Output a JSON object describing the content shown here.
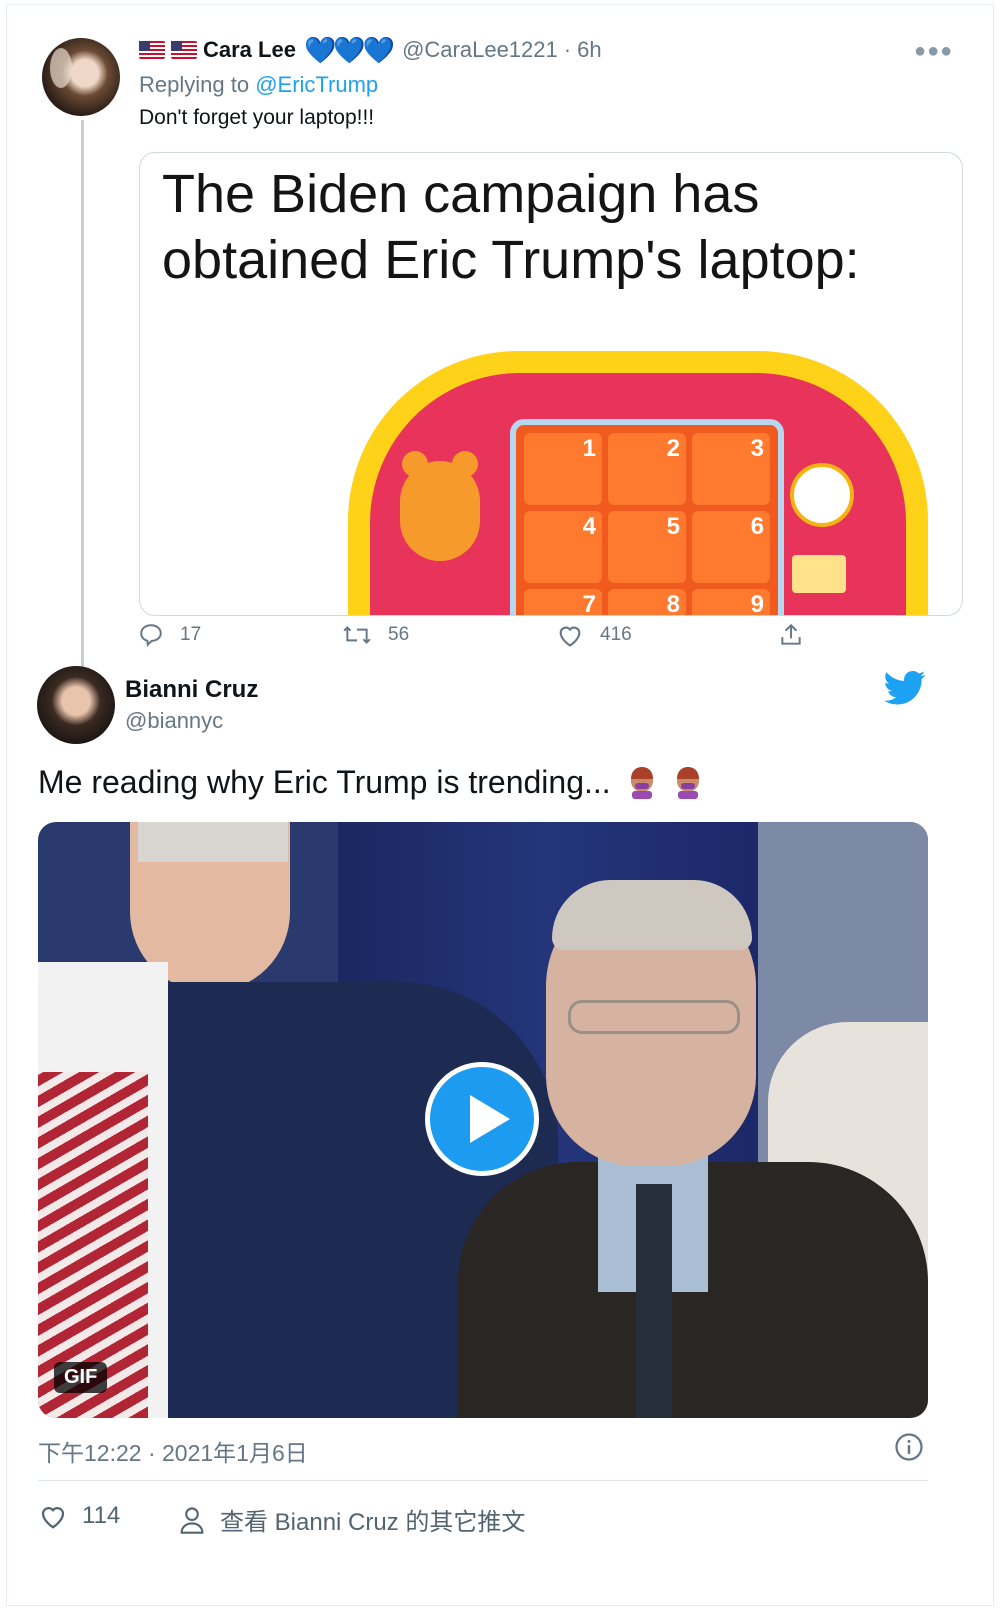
{
  "reply_tweet": {
    "author_name": "Cara Lee",
    "author_flags": [
      "US flag",
      "US flag"
    ],
    "author_hearts": "💙💙💙",
    "author_handle": "@CaraLee1221",
    "separator": "·",
    "time_ago": "6h",
    "replying_prefix": "Replying to",
    "replying_handle": "@EricTrump",
    "text": "Don't forget your laptop!!!",
    "media": {
      "caption_line1": "The Biden campaign has",
      "caption_line2": "obtained Eric Trump's laptop:",
      "toy_keys": [
        "1",
        "2",
        "3",
        "4",
        "5",
        "6",
        "7",
        "8",
        "9"
      ]
    },
    "actions": {
      "replies": "17",
      "retweets": "56",
      "likes": "416"
    }
  },
  "main_tweet": {
    "author_name": "Bianni Cruz",
    "author_handle": "@biannyc",
    "text": "Me reading why Eric Trump is trending...",
    "media_badge": "GIF",
    "timestamp": "下午12:22 · 2021年1月6日",
    "likes": "114",
    "view_more": "查看 Bianni Cruz 的其它推文"
  },
  "colors": {
    "accent": "#1da1f2",
    "muted": "#657786",
    "heart_blue": "#2f9fe8"
  }
}
